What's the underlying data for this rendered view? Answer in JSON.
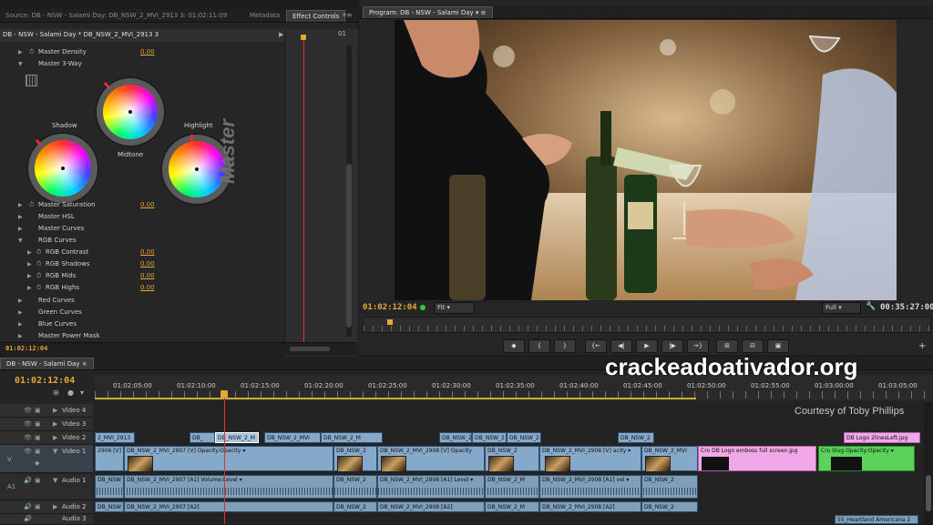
{
  "source_panel": {
    "tabs": [
      "Source: DB - NSW - Salami Day: DB_NSW_2_MVI_2913 3: 01:02:11:09",
      "Metadata",
      "Effect Controls"
    ],
    "header": "DB - NSW - Salami Day * DB_NSW_2_MVI_2913 3",
    "header_tc": "01",
    "rows_top": [
      {
        "label": "Master Density",
        "value": "0.00"
      },
      {
        "label": "Master 3-Way",
        "value": ""
      }
    ],
    "wheels": {
      "shadow": "Shadow",
      "midtone": "Midtone",
      "highlight": "Highlight",
      "vertical_label": "Master"
    },
    "rows_bottom": [
      {
        "label": "Master Saturation",
        "value": "0.00",
        "fx": true
      },
      {
        "label": "Master HSL",
        "value": "",
        "fx": false
      },
      {
        "label": "Master Curves",
        "value": "",
        "fx": false
      },
      {
        "label": "RGB Curves",
        "value": "",
        "fx": false
      }
    ],
    "rgb_rows": [
      {
        "label": "RGB Contrast",
        "value": "0.00"
      },
      {
        "label": "RGB Shadows",
        "value": "0.00"
      },
      {
        "label": "RGB Mids",
        "value": "0.00"
      },
      {
        "label": "RGB Highs",
        "value": "0.00"
      }
    ],
    "rows_tail": [
      "Red Curves",
      "Green Curves",
      "Blue Curves",
      "Master Power Mask"
    ],
    "timecode": "01:02:12:04"
  },
  "program_panel": {
    "tab": "Program: DB - NSW - Salami Day",
    "timecode": "01:02:12:04",
    "fit": "Fit",
    "quality": "Full",
    "duration": "00:35:27:00",
    "controls": [
      "◆",
      "{",
      "}",
      "{←",
      "◀|",
      "▶",
      "|▶",
      "→}",
      "⊞",
      "⊟",
      "▣"
    ]
  },
  "timeline": {
    "tab": "DB - NSW - Salami Day",
    "timecode": "01:02:12:04",
    "ruler": [
      "01:02:05:00",
      "01:02:10:00",
      "01:02:15:00",
      "01:02:20:00",
      "01:02:25:00",
      "01:02:30:00",
      "01:02:35:00",
      "01:02:40:00",
      "01:02:45:00",
      "01:02:50:00",
      "01:02:55:00",
      "01:03:00:00",
      "01:03:05:00"
    ],
    "tracks": {
      "video": [
        "Video 4",
        "Video 3",
        "Video 2",
        "Video 1"
      ],
      "audio": [
        "Audio 1",
        "Audio 2",
        "Audio 3"
      ]
    },
    "title_overlay": "Courtesy of Toby Phillips",
    "watermark": "crackeadoativador.org",
    "v2_clips": [
      {
        "text": "2_MVI_2913"
      },
      {
        "text": "DB_"
      },
      {
        "text": "DB_NSW_2_M"
      },
      {
        "text": "DB_NSW_2_MVI"
      },
      {
        "text": "DB_NSW_2_M"
      },
      {
        "text": "DB_NSW_2"
      },
      {
        "text": "DB_NSW_2"
      },
      {
        "text": "DB_NSW_2"
      },
      {
        "text": "DB_NSW_2"
      },
      {
        "text": "DB Logo 2linesLeft.jpg"
      }
    ],
    "v1_clips": [
      {
        "text": "2906 [V]"
      },
      {
        "text": "DB_NSW_2_MVI_2907 [V] Opacity:Opacity ▾"
      },
      {
        "text": "DB_NSW_2"
      },
      {
        "text": "DB_NSW_2_MVI_2908 [V] Opacity"
      },
      {
        "text": "DB_NSW_2"
      },
      {
        "text": "DB_NSW_2_MVI_2908 [V] acity ▾"
      },
      {
        "text": "DB_NSW_2_MVI"
      },
      {
        "text": "Cro DB Logo emboss full screen.jpg"
      },
      {
        "text": "Cro Slug Opacity:Opacity ▾"
      }
    ],
    "a1_clips": [
      {
        "text": "DB_NSW"
      },
      {
        "text": "DB_NSW_2_MVI_2907 [A1] Volume:Level ▾"
      },
      {
        "text": "DB_NSW_2"
      },
      {
        "text": "DB_NSW_2_MVI_2908 [A1] Level ▾"
      },
      {
        "text": "DB_NSW_2_M"
      },
      {
        "text": "DB_NSW_2_MVI_2908 [A1] vel ▾"
      },
      {
        "text": "DB_NSW_2"
      }
    ],
    "a2_clips": [
      {
        "text": "DB_NSW"
      },
      {
        "text": "DB_NSW_2_MVI_2907 [A2]"
      },
      {
        "text": "DB_NSW_2"
      },
      {
        "text": "DB_NSW_2_MVI_2908 [A2]"
      },
      {
        "text": "DB_NSW_2_M"
      },
      {
        "text": "DB_NSW_2_MVI_2908 [A2]"
      },
      {
        "text": "DB_NSW_2"
      }
    ],
    "a3_clip": "55_Heartland Americana 2"
  },
  "colors": {
    "accent": "#e8a637",
    "playhead": "#e03030",
    "video_clip": "#87a9c9",
    "title_clip": "#f0a8e8",
    "slug": "#5bd35b"
  }
}
